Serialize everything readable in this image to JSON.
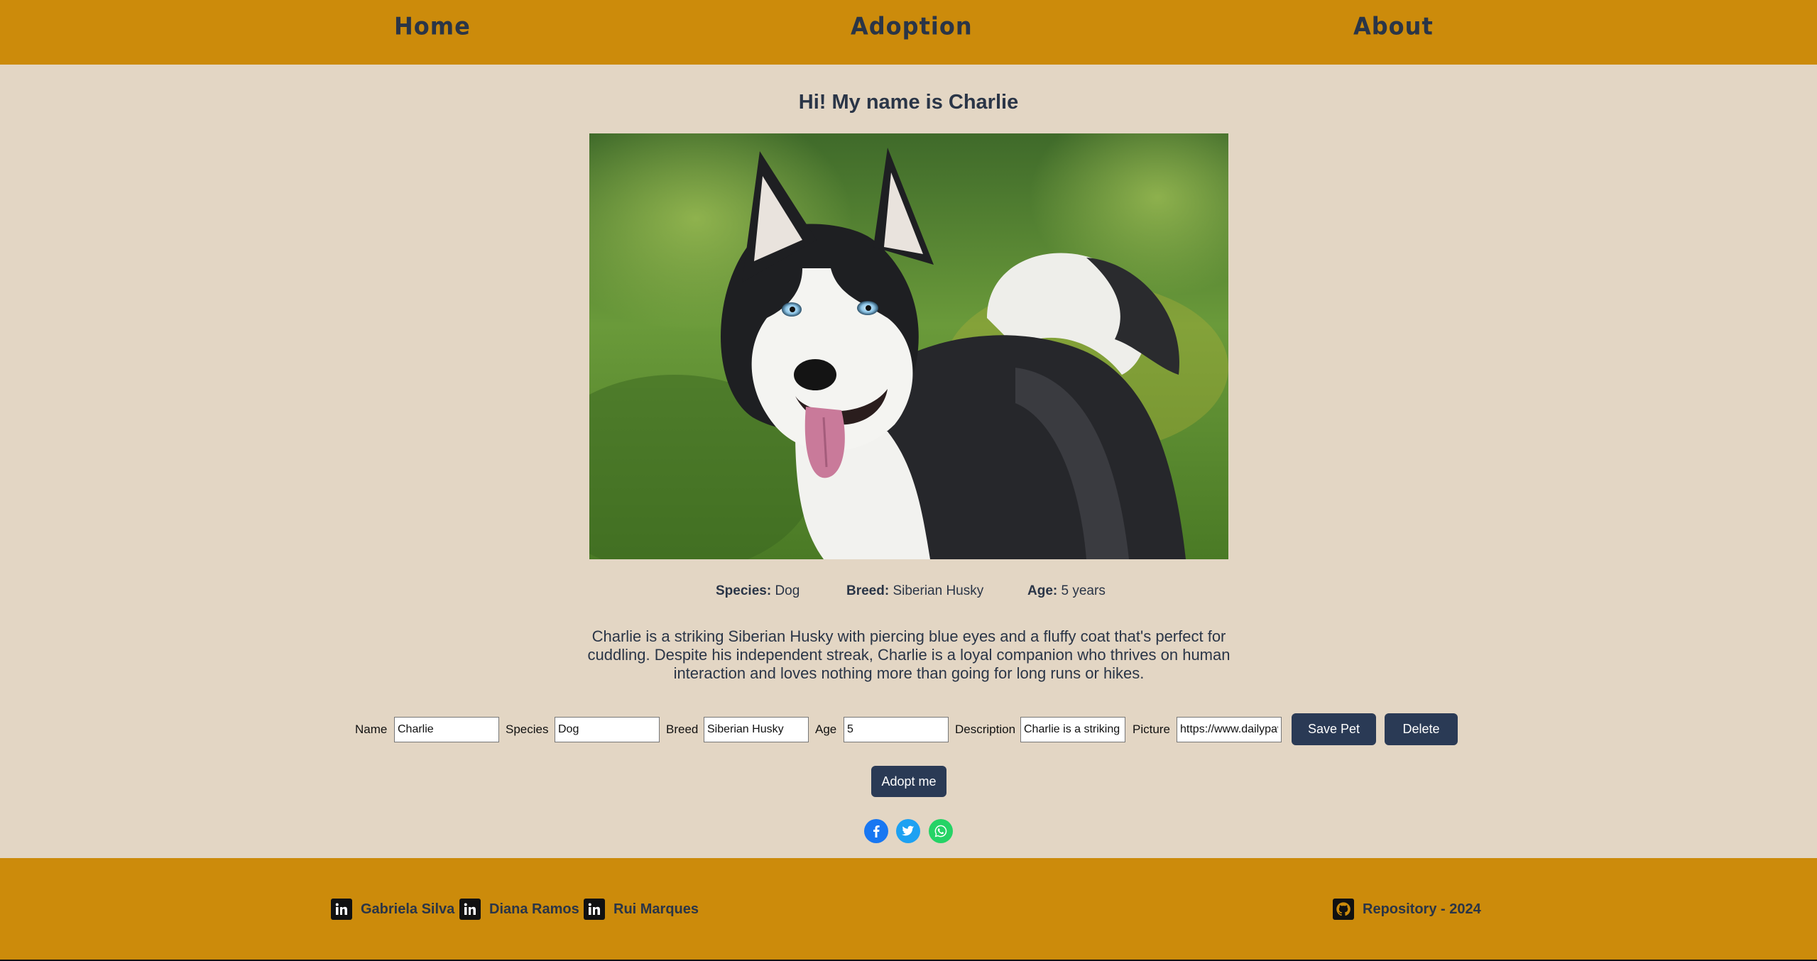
{
  "nav": {
    "home": "Home",
    "adoption": "Adoption",
    "about": "About"
  },
  "pet": {
    "title": "Hi! My name is Charlie",
    "species_label": "Species:",
    "species": "Dog",
    "breed_label": "Breed:",
    "breed": "Siberian Husky",
    "age_label": "Age:",
    "age": "5 years",
    "description": "Charlie is a striking Siberian Husky with piercing blue eyes and a fluffy coat that's perfect for cuddling. Despite his independent streak, Charlie is a loyal companion who thrives on human interaction and loves nothing more than going for long runs or hikes."
  },
  "form": {
    "name_label": "Name",
    "name_value": "Charlie",
    "species_label": "Species",
    "species_value": "Dog",
    "breed_label": "Breed",
    "breed_value": "Siberian Husky",
    "age_label": "Age",
    "age_value": "5",
    "description_label": "Description",
    "description_value": "Charlie is a striking Siberian Husky with piercing blue eyes and a fluffy coat that's perfect for cuddling.",
    "picture_label": "Picture",
    "picture_value": "https://www.dailypaws.com/",
    "save_button": "Save Pet",
    "delete_button": "Delete"
  },
  "adopt_button": "Adopt me",
  "social": [
    {
      "icon": "facebook-icon",
      "color": "#1877f2",
      "glyph": "f"
    },
    {
      "icon": "twitter-icon",
      "color": "#1da1f2",
      "glyph": "t"
    },
    {
      "icon": "whatsapp-icon",
      "color": "#25d366",
      "glyph": "w"
    }
  ],
  "footer": {
    "authors": [
      "Gabriela Silva",
      "Diana Ramos",
      "Rui Marques"
    ],
    "repository": "Repository - 2024"
  },
  "colors": {
    "header_bg": "#cc8b0b",
    "page_bg": "#e3d6c4",
    "text": "#2a3547",
    "button": "#2a3a55"
  }
}
